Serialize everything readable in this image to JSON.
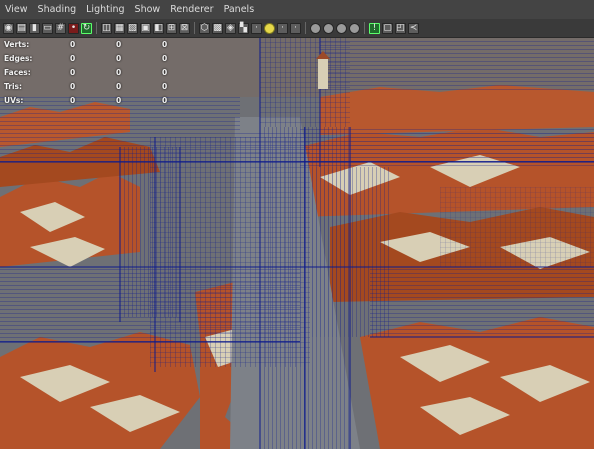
{
  "menubar": {
    "items": [
      "View",
      "Shading",
      "Lighting",
      "Show",
      "Renderer",
      "Panels"
    ]
  },
  "toolbar": {
    "icons": [
      "camera-icon",
      "film-icon",
      "bookmark-icon",
      "image-plane-icon",
      "grid-icon",
      "snapshot-icon",
      "isolate-icon",
      "wireframe-icon",
      "smooth-shade-icon",
      "textured-icon",
      "lights-icon",
      "shadows-icon",
      "grid-view-icon",
      "xray-icon",
      "cube-wire-icon",
      "cube-shaded-icon",
      "cube-textured-icon",
      "checker-icon",
      "default-light-icon",
      "all-lights-icon",
      "sun-icon",
      "point-light-icon",
      "spot-light-icon",
      "sphere-icon",
      "sphere-smooth-icon",
      "sphere-shaded-icon",
      "sphere-rim-icon",
      "resolution-gate-icon",
      "film-gate-icon",
      "safe-area-icon",
      "share-icon"
    ]
  },
  "hud": {
    "rows": [
      {
        "label": "Verts:",
        "values": [
          "0",
          "0",
          "0"
        ]
      },
      {
        "label": "Edges:",
        "values": [
          "0",
          "0",
          "0"
        ]
      },
      {
        "label": "Faces:",
        "values": [
          "0",
          "0",
          "0"
        ]
      },
      {
        "label": "Tris:",
        "values": [
          "0",
          "0",
          "0"
        ]
      },
      {
        "label": "UVs:",
        "values": [
          "0",
          "0",
          "0"
        ]
      }
    ]
  },
  "colors": {
    "wireframe": "#0d1a8c",
    "roof": "#b5532a",
    "wall": "#d8cfb5",
    "ground": "#6e7075"
  }
}
